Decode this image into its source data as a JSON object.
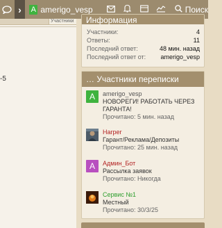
{
  "nav": {
    "user_initial": "A",
    "user_name": "amerigo_vesp",
    "search_label": "Поиск",
    "icons": [
      "chat-icon",
      "chevron-right-icon",
      "mail-icon",
      "bell-icon",
      "bookmarks-icon",
      "stats-icon",
      "search-icon"
    ]
  },
  "left": {
    "tab_label": "Участники",
    "stray_text": "-5"
  },
  "info": {
    "title": "Информация",
    "rows": [
      {
        "label": "Участники:",
        "value": "4"
      },
      {
        "label": "Ответы:",
        "value": "11"
      },
      {
        "label": "Последний ответ:",
        "value": "48 мин. назад"
      },
      {
        "label": "Последний ответ от:",
        "value": "amerigo_vesp"
      }
    ]
  },
  "members": {
    "title": "… Участники переписки",
    "items": [
      {
        "initial": "A",
        "avatar_color": "#3fb33f",
        "name": "amerigo_vesp",
        "name_color": "#555555",
        "line1": "НОВОРЕГИ! РАБОТАТЬ ЧЕРЕЗ ГАРАНТА!",
        "read": "Прочитано: 5 мин. назад"
      },
      {
        "initial": "",
        "avatar_color": "#5a6a7a",
        "name": "Harper",
        "name_color": "#b22222",
        "line1": "Гарант/Реклама/Депозиты",
        "read": "Прочитано: 25 мин. назад"
      },
      {
        "initial": "A",
        "avatar_color": "#b84fbf",
        "name": "Админ_Бот",
        "name_color": "#b22222",
        "line1": "Рассылка заявок",
        "read": "Прочитано: Никогда"
      },
      {
        "initial": "",
        "avatar_color": "#7a3a1a",
        "name": "Сервис №1",
        "name_color": "#2e9e2e",
        "line1": "Местный",
        "read": "Прочитано: 30/3/25"
      }
    ]
  }
}
